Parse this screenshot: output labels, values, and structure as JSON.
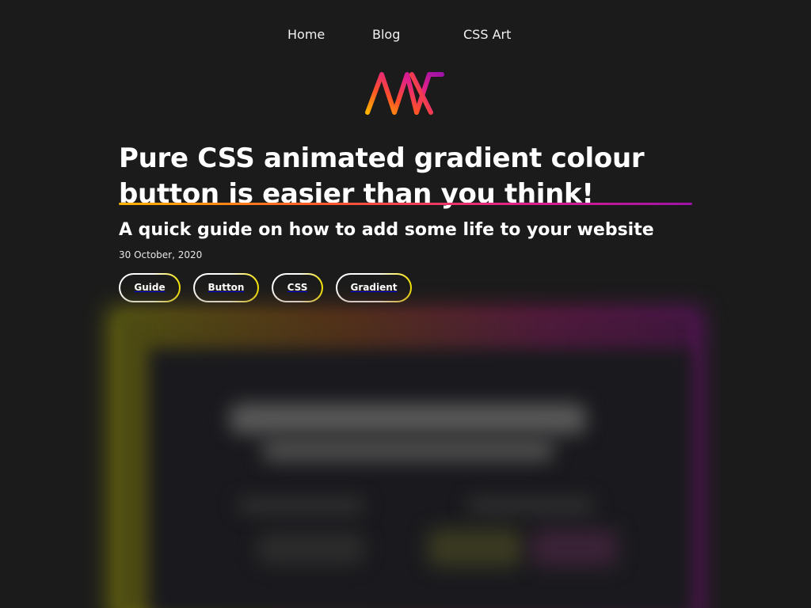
{
  "nav": {
    "items": [
      {
        "label": "Home"
      },
      {
        "label": "Blog"
      },
      {
        "label": "CSS Art"
      }
    ]
  },
  "logo": {
    "icon": "aw-gradient-logo-icon",
    "colors": [
      "#ffb300",
      "#ff4f2a",
      "#e0208a",
      "#a012a8"
    ]
  },
  "article": {
    "title": "Pure CSS animated gradient colour button is easier than you think!",
    "subtitle": "A quick guide on how to add some life to your website",
    "date": "30 October, 2020",
    "tags": [
      {
        "label": "Guide"
      },
      {
        "label": "Button"
      },
      {
        "label": "CSS"
      },
      {
        "label": "Gradient"
      }
    ]
  },
  "colors": {
    "background": "#1b1b1b",
    "text": "#ffffff",
    "accent_start": "#ffb300",
    "accent_end": "#a012a8",
    "tag_border_accent": "#f5e300"
  }
}
